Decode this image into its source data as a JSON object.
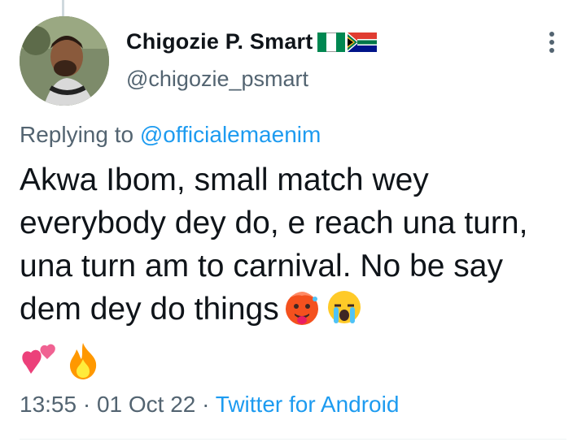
{
  "tweet": {
    "display_name": "Chigozie P. Smart",
    "handle": "@chigozie_psmart",
    "replying_prefix": "Replying to ",
    "replying_to": "@officialemaenim",
    "text": "Akwa Ibom, small match wey everybody dey do, e reach una turn, una turn am to carnival. No be say dem dey do things",
    "time": "13:55",
    "separator": " · ",
    "date": "01 Oct 22",
    "source": "Twitter for Android",
    "flags": [
      "nigeria-flag",
      "south-africa-flag"
    ],
    "emojis_inline": [
      "hot-face-emoji",
      "crying-face-emoji"
    ],
    "emojis_row": [
      "two-hearts-emoji",
      "fire-emoji"
    ]
  },
  "colors": {
    "text": "#0f1419",
    "secondary": "#536471",
    "link": "#1d9bf0"
  }
}
